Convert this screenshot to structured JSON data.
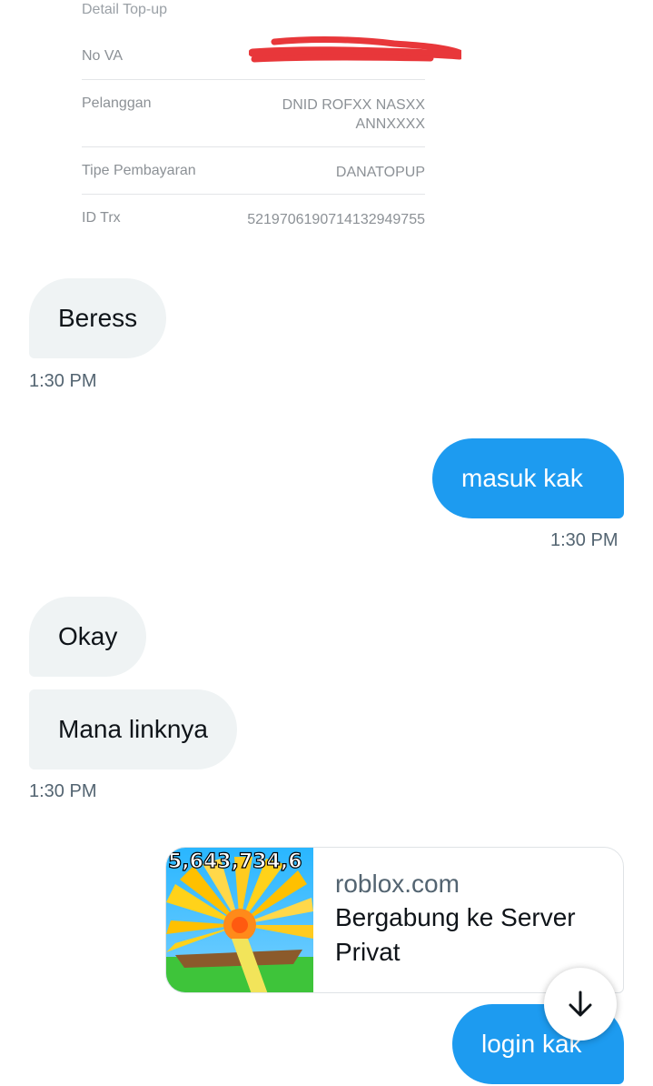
{
  "receipt": {
    "title": "Detail Top-up",
    "rows": [
      {
        "label": "No VA",
        "value": ""
      },
      {
        "label": "Pelanggan",
        "value": "DNID ROFXX NASXX ANNXXXX"
      },
      {
        "label": "Tipe Pembayaran",
        "value": "DANATOPUP"
      },
      {
        "label": "ID Trx",
        "value": "5219706190714132949755"
      }
    ],
    "redaction_color": "#e8373a"
  },
  "messages": [
    {
      "side": "in",
      "text": "Beress"
    },
    {
      "side": "out",
      "text": "masuk kak"
    },
    {
      "side": "in",
      "text": "Okay"
    },
    {
      "side": "in",
      "text": "Mana linknya"
    },
    {
      "side": "out",
      "text": "login kak"
    }
  ],
  "timestamps": {
    "t1": "1:30 PM",
    "t2": "1:30 PM",
    "t3": "1:30 PM"
  },
  "link_card": {
    "domain": "roblox.com",
    "title": "Bergabung ke Server Privat",
    "thumbnail_text": "5,643,734,6"
  },
  "scroll_button": {
    "icon": "arrow-down-icon"
  },
  "colors": {
    "outgoing_bubble": "#1d9bf0",
    "incoming_bubble": "#eff3f4",
    "timestamp": "#536471"
  }
}
